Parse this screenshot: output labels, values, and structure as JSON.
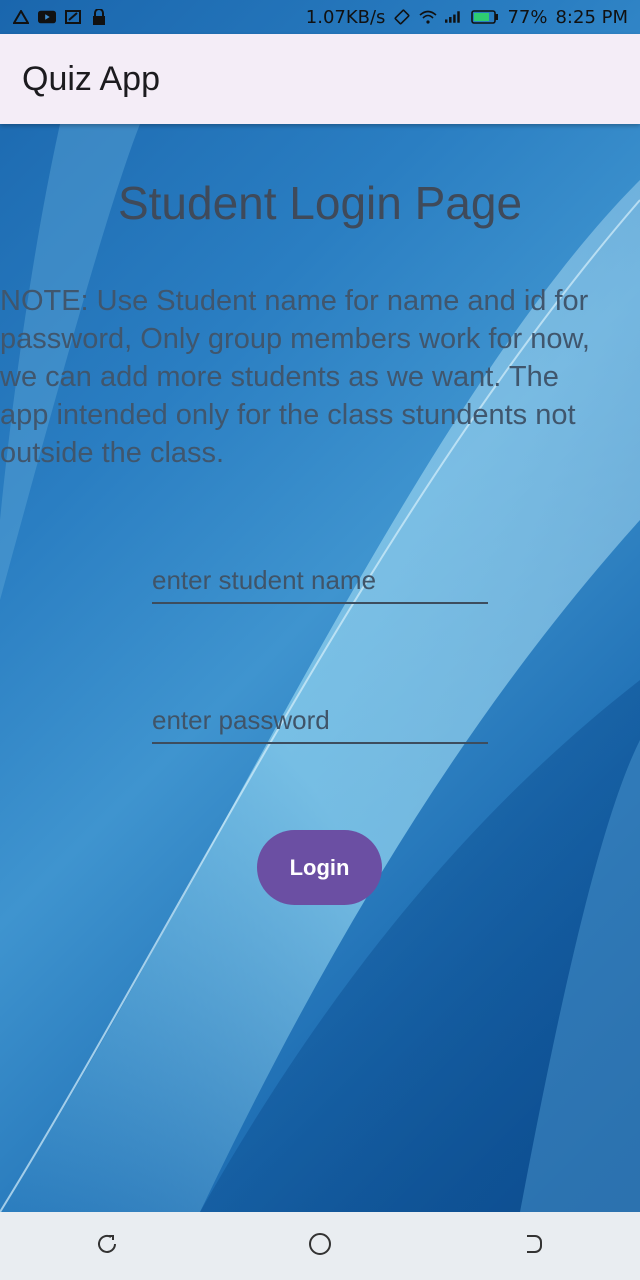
{
  "status_bar": {
    "speed": "1.07KB/s",
    "battery": "77%",
    "time": "8:25 PM",
    "left_icons": [
      "alert-icon",
      "youtube-icon",
      "screenshot-icon",
      "lock-icon"
    ],
    "right_icons": [
      "rotate-icon",
      "wifi-icon",
      "signal-icon",
      "battery-icon"
    ]
  },
  "app_bar": {
    "title": "Quiz App"
  },
  "main": {
    "page_title": "Student Login Page",
    "note": "NOTE: Use Student name for name and id for password, Only group members work for now, we can add more students as we want. The app intended only for the class stundents not outside the class.",
    "name_field": {
      "value": "",
      "placeholder": "enter student name"
    },
    "password_field": {
      "value": "",
      "placeholder": "enter password"
    },
    "login_label": "Login"
  },
  "nav_bar": {
    "buttons": [
      "back-icon",
      "home-icon",
      "recents-icon"
    ]
  },
  "colors": {
    "app_bar_bg": "#f4edf7",
    "accent": "#6b4fa3",
    "background": "#1f6fb4"
  }
}
